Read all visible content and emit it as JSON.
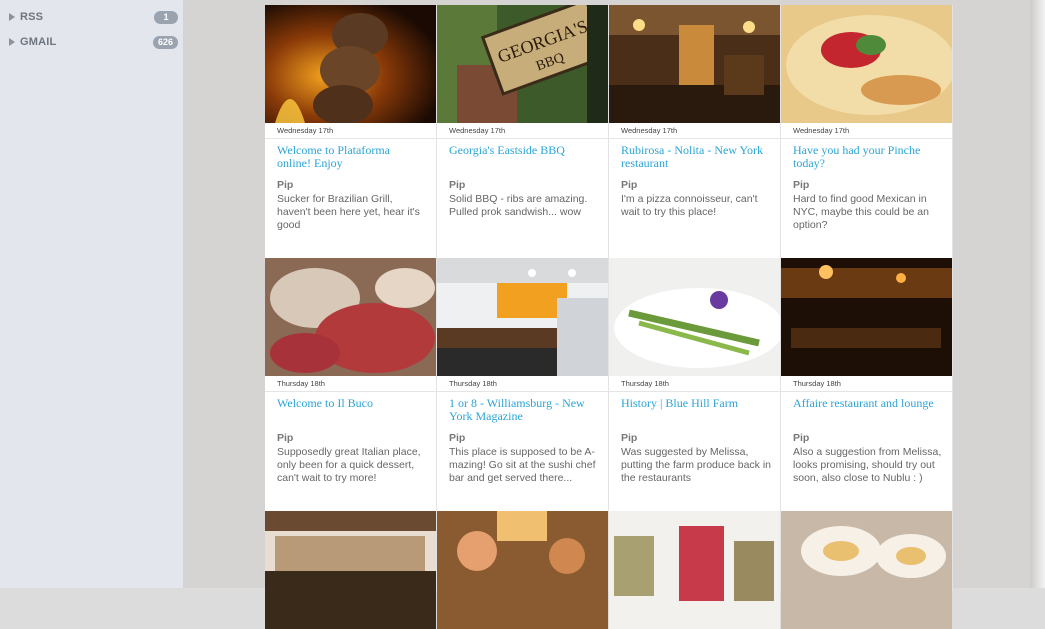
{
  "sidebar": {
    "items": [
      {
        "label": "RSS",
        "count": "1"
      },
      {
        "label": "GMAIL",
        "count": "626"
      }
    ]
  },
  "cards": [
    {
      "date": "Wednesday 17th",
      "title": "Welcome to Plataforma online! Enjoy",
      "author": "Pip",
      "note": "Sucker for Brazilian Grill, haven't been here yet, hear it's good",
      "image": "grilled-meat-photo"
    },
    {
      "date": "Wednesday 17th",
      "title": "Georgia's Eastside BBQ",
      "author": "Pip",
      "note": "Solid BBQ - ribs are amazing. Pulled prok sandwish... wow",
      "image": "bbq-sign-photo"
    },
    {
      "date": "Wednesday 17th",
      "title": "Rubirosa - Nolita - New York restaurant",
      "author": "Pip",
      "note": "I'm a pizza connoisseur, can't wait to try this place!",
      "image": "restaurant-interior-photo"
    },
    {
      "date": "Wednesday 17th",
      "title": "Have you had your Pinche today?",
      "author": "Pip",
      "note": "Hard to find good Mexican in NYC, maybe this could be an option?",
      "image": "mexican-dish-photo"
    },
    {
      "date": "Thursday 18th",
      "title": "Welcome to Il Buco",
      "author": "Pip",
      "note": "Supposedly great Italian place, only been for a quick dessert, can't wait to try more!",
      "image": "charcuterie-photo"
    },
    {
      "date": "Thursday 18th",
      "title": "1 or 8 - Williamsburg - New York Magazine",
      "author": "Pip",
      "note": "This place is supposed to be A-mazing! Go sit at the sushi chef bar and get served there...",
      "image": "white-dining-room-photo"
    },
    {
      "date": "Thursday 18th",
      "title": "History | Blue Hill Farm",
      "author": "Pip",
      "note": "Was suggested by Melissa, putting the farm produce back in the restaurants",
      "image": "asparagus-plate-photo"
    },
    {
      "date": "Thursday 18th",
      "title": "Affaire restaurant and  lounge",
      "author": "Pip",
      "note": "Also a suggestion from Melissa, looks promising, should try out soon, also close to Nublu : )",
      "image": "dark-lounge-photo"
    },
    {
      "date": "",
      "title": "",
      "author": "",
      "note": "",
      "image": "bar-counter-photo"
    },
    {
      "date": "",
      "title": "",
      "author": "",
      "note": "",
      "image": "busy-restaurant-photo"
    },
    {
      "date": "",
      "title": "",
      "author": "",
      "note": "",
      "image": "preserves-jars-photo"
    },
    {
      "date": "",
      "title": "",
      "author": "",
      "note": "",
      "image": "appetizer-plate-photo"
    }
  ]
}
